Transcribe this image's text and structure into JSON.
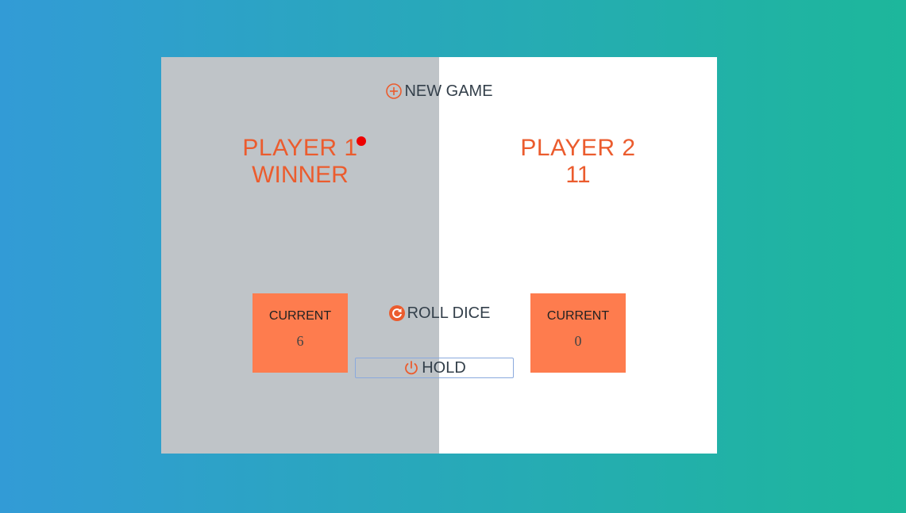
{
  "buttons": {
    "new_game": "NEW GAME",
    "roll_dice": "ROLL DICE",
    "hold": "HOLD"
  },
  "players": [
    {
      "name": "PLAYER 1",
      "score": "WINNER",
      "current_label": "CURRENT",
      "current_score": "6",
      "active": true
    },
    {
      "name": "PLAYER 2",
      "score": "11",
      "current_label": "CURRENT",
      "current_score": "0",
      "active": false
    }
  ],
  "icons": {
    "new_game": "plus-circle-icon",
    "roll_dice": "refresh-icon",
    "hold": "power-icon"
  },
  "colors": {
    "accent": "#eb5c2e",
    "current_box": "#fe7c4e",
    "active_panel": "#bfc4c8",
    "active_dot": "#ee0000",
    "gradient_start": "#329bd6",
    "gradient_end": "#1db79b"
  }
}
